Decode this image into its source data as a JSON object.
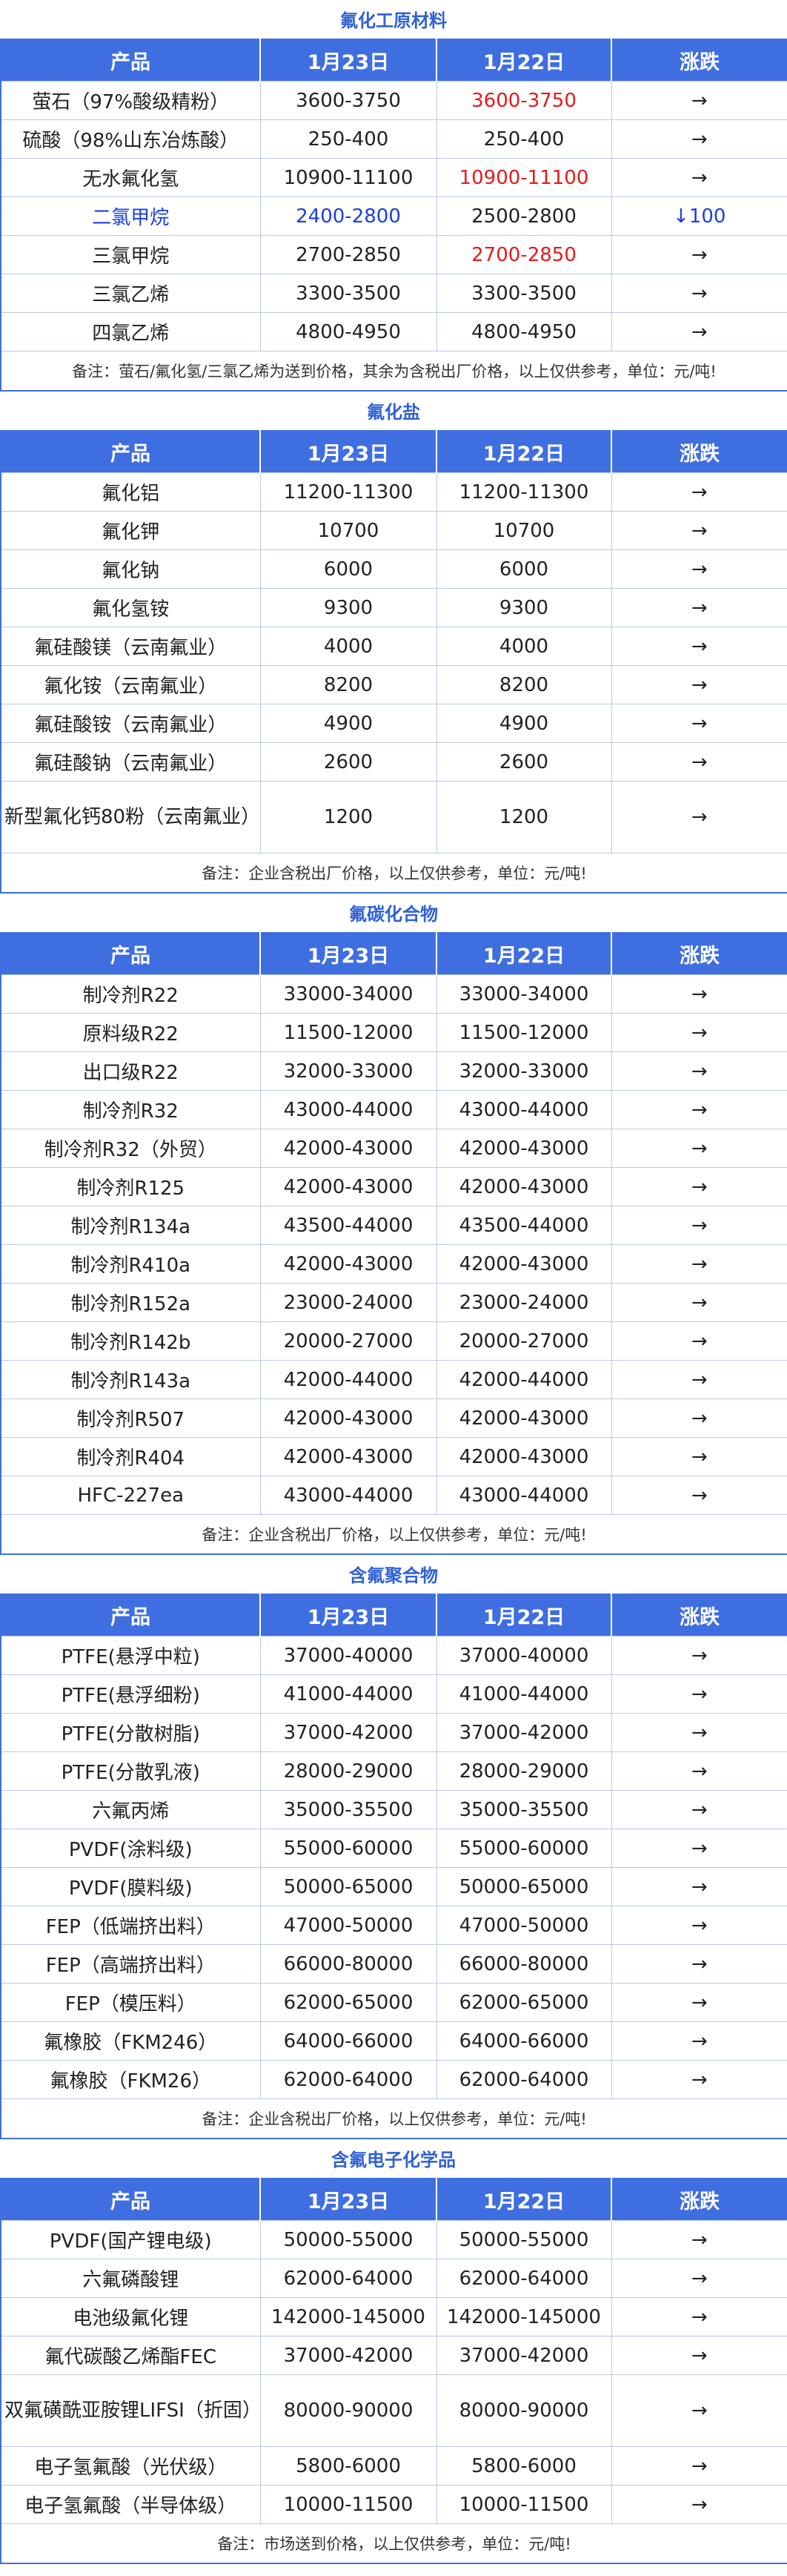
{
  "columns": [
    "产品",
    "1月23日",
    "1月22日",
    "涨跌"
  ],
  "colors": {
    "header_bg": "#3f6ee0",
    "title": "#2f61d6",
    "red": "#e41b1b",
    "blue": "#1a3fe0"
  },
  "sections": [
    {
      "title": "氟化工原材料",
      "rows": [
        [
          "萤石（97%酸级精粉）",
          "3600-3750",
          "3600-3750",
          "→"
        ],
        [
          "硫酸（98%山东冶炼酸）",
          "250-400",
          "250-400",
          "→"
        ],
        [
          "无水氟化氢",
          "10900-11100",
          "10900-11100",
          "→"
        ],
        [
          "二氯甲烷",
          "2400-2800",
          "2500-2800",
          "↓100"
        ],
        [
          "三氯甲烷",
          "2700-2850",
          "2700-2850",
          "→"
        ],
        [
          "三氯乙烯",
          "3300-3500",
          "3300-3500",
          "→"
        ],
        [
          "四氯乙烯",
          "4800-4950",
          "4800-4950",
          "→"
        ]
      ],
      "styles": [
        [
          "",
          "",
          "red",
          ""
        ],
        [
          "",
          "",
          "",
          ""
        ],
        [
          "",
          "",
          "red",
          ""
        ],
        [
          "blue",
          "blue",
          "",
          "blue"
        ],
        [
          "",
          "",
          "red",
          ""
        ],
        [
          "",
          "",
          "",
          ""
        ],
        [
          "",
          "",
          "",
          ""
        ]
      ],
      "note": "备注：萤石/氟化氢/三氯乙烯为送到价格，其余为含税出厂价格，以上仅供参考，单位：元/吨!"
    },
    {
      "title": "氟化盐",
      "rows": [
        [
          "氟化铝",
          "11200-11300",
          "11200-11300",
          "→"
        ],
        [
          "氟化钾",
          "10700",
          "10700",
          "→"
        ],
        [
          "氟化钠",
          "6000",
          "6000",
          "→"
        ],
        [
          "氟化氢铵",
          "9300",
          "9300",
          "→"
        ],
        [
          "氟硅酸镁（云南氟业）",
          "4000",
          "4000",
          "→"
        ],
        [
          "氟化铵（云南氟业）",
          "8200",
          "8200",
          "→"
        ],
        [
          "氟硅酸铵（云南氟业）",
          "4900",
          "4900",
          "→"
        ],
        [
          "氟硅酸钠（云南氟业）",
          "2600",
          "2600",
          "→"
        ],
        [
          "新型氟化钙80粉（云南氟业）",
          "1200",
          "1200",
          "→"
        ]
      ],
      "note": "备注：企业含税出厂价格，以上仅供参考，单位：元/吨!"
    },
    {
      "title": "氟碳化合物",
      "rows": [
        [
          "制冷剂R22",
          "33000-34000",
          "33000-34000",
          "→"
        ],
        [
          "原料级R22",
          "11500-12000",
          "11500-12000",
          "→"
        ],
        [
          "出口级R22",
          "32000-33000",
          "32000-33000",
          "→"
        ],
        [
          "制冷剂R32",
          "43000-44000",
          "43000-44000",
          "→"
        ],
        [
          "制冷剂R32（外贸）",
          "42000-43000",
          "42000-43000",
          "→"
        ],
        [
          "制冷剂R125",
          "42000-43000",
          "42000-43000",
          "→"
        ],
        [
          "制冷剂R134a",
          "43500-44000",
          "43500-44000",
          "→"
        ],
        [
          "制冷剂R410a",
          "42000-43000",
          "42000-43000",
          "→"
        ],
        [
          "制冷剂R152a",
          "23000-24000",
          "23000-24000",
          "→"
        ],
        [
          "制冷剂R142b",
          "20000-27000",
          "20000-27000",
          "→"
        ],
        [
          "制冷剂R143a",
          "42000-44000",
          "42000-44000",
          "→"
        ],
        [
          "制冷剂R507",
          "42000-43000",
          "42000-43000",
          "→"
        ],
        [
          "制冷剂R404",
          "42000-43000",
          "42000-43000",
          "→"
        ],
        [
          "HFC-227ea",
          "43000-44000",
          "43000-44000",
          "→"
        ]
      ],
      "note": "备注：企业含税出厂价格，以上仅供参考，单位：元/吨!"
    },
    {
      "title": "含氟聚合物",
      "rows": [
        [
          "PTFE(悬浮中粒)",
          "37000-40000",
          "37000-40000",
          "→"
        ],
        [
          "PTFE(悬浮细粉)",
          "41000-44000",
          "41000-44000",
          "→"
        ],
        [
          "PTFE(分散树脂)",
          "37000-42000",
          "37000-42000",
          "→"
        ],
        [
          "PTFE(分散乳液)",
          "28000-29000",
          "28000-29000",
          "→"
        ],
        [
          "六氟丙烯",
          "35000-35500",
          "35000-35500",
          "→"
        ],
        [
          "PVDF(涂料级)",
          "55000-60000",
          "55000-60000",
          "→"
        ],
        [
          "PVDF(膜料级)",
          "50000-65000",
          "50000-65000",
          "→"
        ],
        [
          "FEP（低端挤出料）",
          "47000-50000",
          "47000-50000",
          "→"
        ],
        [
          "FEP（高端挤出料）",
          "66000-80000",
          "66000-80000",
          "→"
        ],
        [
          "FEP（模压料）",
          "62000-65000",
          "62000-65000",
          "→"
        ],
        [
          "氟橡胶（FKM246）",
          "64000-66000",
          "64000-66000",
          "→"
        ],
        [
          "氟橡胶（FKM26）",
          "62000-64000",
          "62000-64000",
          "→"
        ]
      ],
      "note": "备注：企业含税出厂价格，以上仅供参考，单位：元/吨!"
    },
    {
      "title": "含氟电子化学品",
      "rows": [
        [
          "PVDF(国产锂电级)",
          "50000-55000",
          "50000-55000",
          "→"
        ],
        [
          "六氟磷酸锂",
          "62000-64000",
          "62000-64000",
          "→"
        ],
        [
          "电池级氟化锂",
          "142000-145000",
          "142000-145000",
          "→"
        ],
        [
          "氟代碳酸乙烯酯FEC",
          "37000-42000",
          "37000-42000",
          "→"
        ],
        [
          "双氟磺酰亚胺锂LIFSI（折固）",
          "80000-90000",
          "80000-90000",
          "→"
        ],
        [
          "电子氢氟酸（光伏级）",
          "5800-6000",
          "5800-6000",
          "→"
        ],
        [
          "电子氢氟酸（半导体级）",
          "10000-11500",
          "10000-11500",
          "→"
        ]
      ],
      "note": "备注：市场送到价格，以上仅供参考，单位：元/吨!"
    }
  ]
}
